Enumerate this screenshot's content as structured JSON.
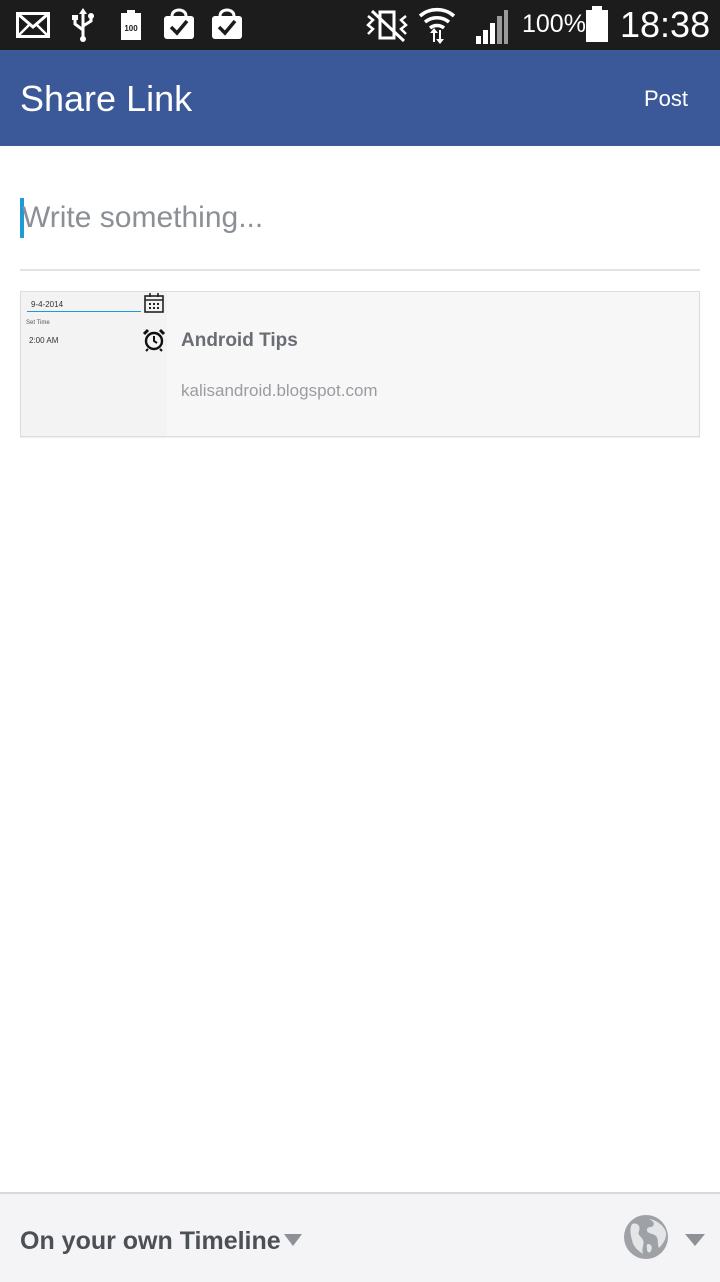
{
  "status_bar": {
    "battery_percent": "100%",
    "time": "18:38",
    "icons": [
      "mail-icon",
      "usb-icon",
      "battery-100-icon",
      "shopping-bag-check-icon",
      "shopping-bag-check-icon",
      "vibrate-mute-icon",
      "wifi-icon",
      "signal-icon",
      "battery-icon"
    ]
  },
  "app_bar": {
    "title": "Share Link",
    "post_label": "Post",
    "color": "#3b5998"
  },
  "composer": {
    "placeholder": "Write something...",
    "value": ""
  },
  "link_preview": {
    "title": "Android Tips",
    "domain": "kalisandroid.blogspot.com",
    "thumbnail": {
      "date": "9-4-2014",
      "set_time_label": "Set Time",
      "time": "2:00 AM"
    }
  },
  "bottom_bar": {
    "audience_label": "On your own Timeline",
    "privacy_icon": "globe-icon"
  }
}
